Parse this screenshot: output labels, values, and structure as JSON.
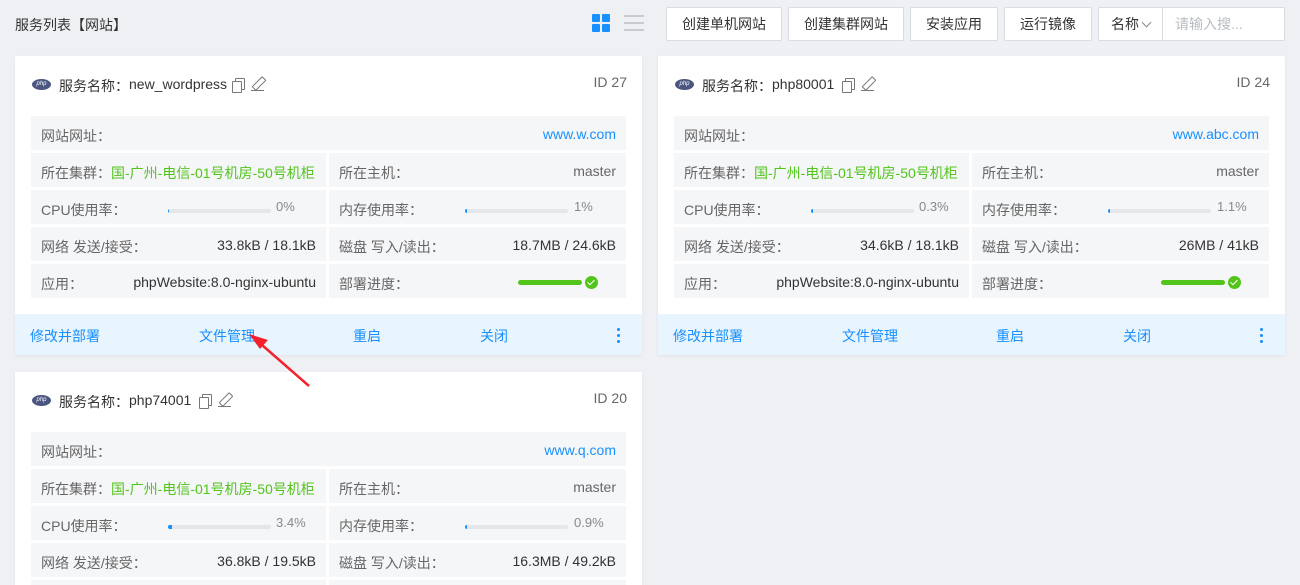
{
  "header": {
    "title": "服务列表【网站】",
    "view_icons": [
      "grid-view-icon",
      "list-view-icon"
    ],
    "buttons": {
      "create_single": "创建单机网站",
      "create_cluster": "创建集群网站",
      "install_app": "安装应用",
      "run_image": "运行镜像"
    },
    "search": {
      "field": "名称",
      "placeholder": "请输入搜..."
    }
  },
  "labels": {
    "service_name": "服务名称：",
    "website_url": "网站网址：",
    "cluster": "所在集群：",
    "host": "所在主机：",
    "cpu": "CPU使用率：",
    "memory": "内存使用率：",
    "network": "网络 发送/接受：",
    "disk": "磁盘 写入/读出：",
    "app": "应用：",
    "deploy": "部署进度："
  },
  "actions": {
    "edit_deploy": "修改并部署",
    "file_manager": "文件管理",
    "restart": "重启",
    "close": "关闭"
  },
  "colors": {
    "accent": "#1890ff",
    "success": "#52c41a",
    "footer_bg": "#e8f4fe"
  },
  "cards": [
    {
      "name": "new_wordpress",
      "id": "ID 27",
      "url": "www.w.com",
      "cluster": "国-广州-电信-01号机房-50号机柜",
      "host": "master",
      "cpu": "0%",
      "cpu_fraction": 0,
      "memory": "1%",
      "memory_fraction": 0.01,
      "network": "33.8kB / 18.1kB",
      "disk": "18.7MB / 24.6kB",
      "app": "phpWebsite:8.0-nginx-ubuntu",
      "deploy_fraction": 1
    },
    {
      "name": "php80001",
      "id": "ID 24",
      "url": "www.abc.com",
      "cluster": "国-广州-电信-01号机房-50号机柜",
      "host": "master",
      "cpu": "0.3%",
      "cpu_fraction": 0.003,
      "memory": "1.1%",
      "memory_fraction": 0.011,
      "network": "34.6kB / 18.1kB",
      "disk": "26MB / 41kB",
      "app": "phpWebsite:8.0-nginx-ubuntu",
      "deploy_fraction": 1
    },
    {
      "name": "php74001",
      "id": "ID 20",
      "url": "www.q.com",
      "cluster": "国-广州-电信-01号机房-50号机柜",
      "host": "master",
      "cpu": "3.4%",
      "cpu_fraction": 0.034,
      "memory": "0.9%",
      "memory_fraction": 0.009,
      "network": "36.8kB / 19.5kB",
      "disk": "16.3MB / 49.2kB"
    }
  ]
}
